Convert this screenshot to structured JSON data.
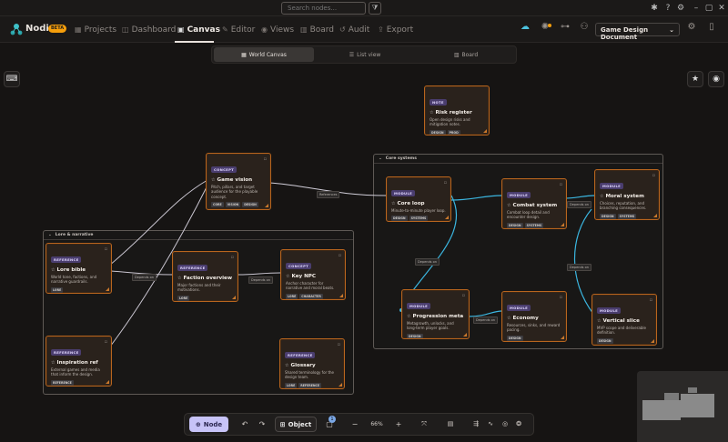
{
  "titlebar": {
    "search_placeholder": "Search nodes...",
    "filter_icon": "filter-icon"
  },
  "nav": {
    "brand": "Nodio",
    "beta": "BETA",
    "items": [
      {
        "label": "Projects",
        "icon": "grid-icon"
      },
      {
        "label": "Dashboard",
        "icon": "dashboard-icon"
      },
      {
        "label": "Canvas",
        "icon": "canvas-icon",
        "active": true
      },
      {
        "label": "Editor",
        "icon": "pencil-icon"
      },
      {
        "label": "Views",
        "icon": "eye-icon"
      },
      {
        "label": "Board",
        "icon": "board-icon"
      },
      {
        "label": "Audit",
        "icon": "history-icon"
      },
      {
        "label": "Export",
        "icon": "export-icon"
      }
    ],
    "document": "Game Design Document"
  },
  "viewtabs": [
    {
      "label": "World Canvas",
      "active": true
    },
    {
      "label": "List view"
    },
    {
      "label": "Board"
    }
  ],
  "groups": {
    "lore": {
      "label": "Lore & narrative"
    },
    "core": {
      "label": "Core systems"
    }
  },
  "nodes": {
    "risk": {
      "badge": "NOTE",
      "title": "Risk register",
      "desc": "Open design risks and mitigation notes.",
      "tags": [
        "DESIGN",
        "PROD"
      ]
    },
    "vision": {
      "badge": "CONCEPT",
      "title": "Game vision",
      "desc": "Pitch, pillars, and target audience for the playable concept.",
      "tags": [
        "CORE",
        "VISION",
        "DESIGN"
      ]
    },
    "coreloop": {
      "badge": "MODULE",
      "title": "Core loop",
      "desc": "Minute-to-minute player loop.",
      "tags": [
        "DESIGN",
        "SYSTEMS"
      ]
    },
    "combat": {
      "badge": "MODULE",
      "title": "Combat system",
      "desc": "Combat loop detail and encounter design.",
      "tags": [
        "DESIGN",
        "SYSTEMS"
      ]
    },
    "moral": {
      "badge": "MODULE",
      "title": "Moral system",
      "desc": "Choices, reputation, and branching consequences.",
      "tags": [
        "DESIGN",
        "SYSTEMS"
      ]
    },
    "progression": {
      "badge": "MODULE",
      "title": "Progression meta",
      "desc": "Metagrowth, unlocks, and long-term player goals.",
      "tags": [
        "DESIGN"
      ]
    },
    "economy": {
      "badge": "MODULE",
      "title": "Economy",
      "desc": "Resources, sinks, and reward pacing.",
      "tags": [
        "DESIGN"
      ]
    },
    "vslice": {
      "badge": "MODULE",
      "title": "Vertical slice",
      "desc": "MVP scope and deliverable definition.",
      "tags": [
        "DESIGN"
      ]
    },
    "lorebible": {
      "badge": "REFERENCE",
      "title": "Lore bible",
      "desc": "World tone, factions, and narrative guardrails.",
      "tags": [
        "LORE"
      ]
    },
    "faction": {
      "badge": "REFERENCE",
      "title": "Faction overview",
      "desc": "Major factions and their motivations.",
      "tags": [
        "LORE"
      ]
    },
    "npc": {
      "badge": "CONCEPT",
      "title": "Key NPC",
      "desc": "Anchor character for narrative and moral beats.",
      "tags": [
        "LORE",
        "CHARACTER"
      ]
    },
    "inspo": {
      "badge": "REFERENCE",
      "title": "Inspiration ref",
      "desc": "External games and media that inform the design.",
      "tags": [
        "REFERENCE"
      ]
    },
    "glossary": {
      "badge": "REFERENCE",
      "title": "Glossary",
      "desc": "Shared terminology for the design team.",
      "tags": [
        "LORE",
        "REFERENCE"
      ]
    }
  },
  "edges": {
    "e1": "References",
    "e2": "Depends on",
    "e3": "Depends on",
    "e4": "Depends on",
    "e5": "Depends on",
    "e6": "Depends on",
    "e7": "Depends on"
  },
  "toolbar": {
    "node_label": "Node",
    "object_label": "Object",
    "zoom": "66%",
    "badge_count": "1"
  }
}
